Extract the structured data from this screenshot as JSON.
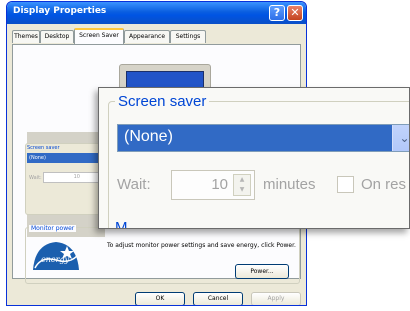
{
  "window": {
    "title": "Display Properties",
    "help_glyph": "?",
    "close_glyph": "✕"
  },
  "tabs": [
    {
      "label": "Themes"
    },
    {
      "label": "Desktop"
    },
    {
      "label": "Screen Saver",
      "active": true
    },
    {
      "label": "Appearance"
    },
    {
      "label": "Settings"
    }
  ],
  "screen_saver_small": {
    "label": "Screen saver",
    "selected": "(None)",
    "wait_label": "Wait:",
    "wait_value": "10"
  },
  "monitor_power": {
    "label": "Monitor power",
    "description": "To adjust monitor power settings and save energy, click Power.",
    "power_button": "Power...",
    "logo_text": "energy"
  },
  "footer": {
    "ok": "OK",
    "cancel": "Cancel",
    "apply": "Apply"
  },
  "zoom": {
    "group_label": "Screen saver",
    "selected": "(None)",
    "arrow_glyph": "⌄",
    "wait_label": "Wait:",
    "wait_value": "10",
    "spin_up": "▲",
    "spin_down": "▼",
    "minutes_label": "minutes",
    "resume_label": "On res",
    "next_group_partial": "M"
  },
  "colors": {
    "title_bar": "#0054e3",
    "selection": "#316ac5",
    "group_label": "#0046d5",
    "disabled_text": "#a3a3a3"
  }
}
